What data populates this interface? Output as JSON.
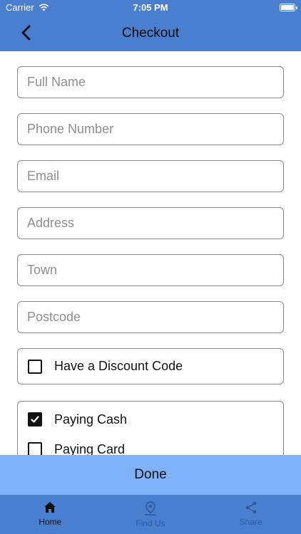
{
  "status_bar": {
    "carrier": "Carrier",
    "time": "7:05 PM"
  },
  "nav": {
    "title": "Checkout",
    "back_icon": "chevron-left-icon"
  },
  "form": {
    "full_name_placeholder": "Full Name",
    "phone_placeholder": "Phone Number",
    "email_placeholder": "Email",
    "address_placeholder": "Address",
    "town_placeholder": "Town",
    "postcode_placeholder": "Postcode"
  },
  "discount": {
    "label": "Have a Discount Code",
    "checked": false
  },
  "payment": {
    "options": [
      {
        "label": "Paying Cash",
        "checked": true
      },
      {
        "label": "Paying Card",
        "checked": false
      }
    ]
  },
  "done_button": {
    "label": "Done"
  },
  "tabs": [
    {
      "label": "Home",
      "icon": "home-icon",
      "active": true
    },
    {
      "label": "Find Us",
      "icon": "location-pin-icon",
      "active": false
    },
    {
      "label": "Share",
      "icon": "share-icon",
      "active": false
    }
  ],
  "colors": {
    "bar_blue": "#4a7fd0",
    "done_blue": "#7fb0fa",
    "inactive_tab": "#2f5aa0"
  }
}
